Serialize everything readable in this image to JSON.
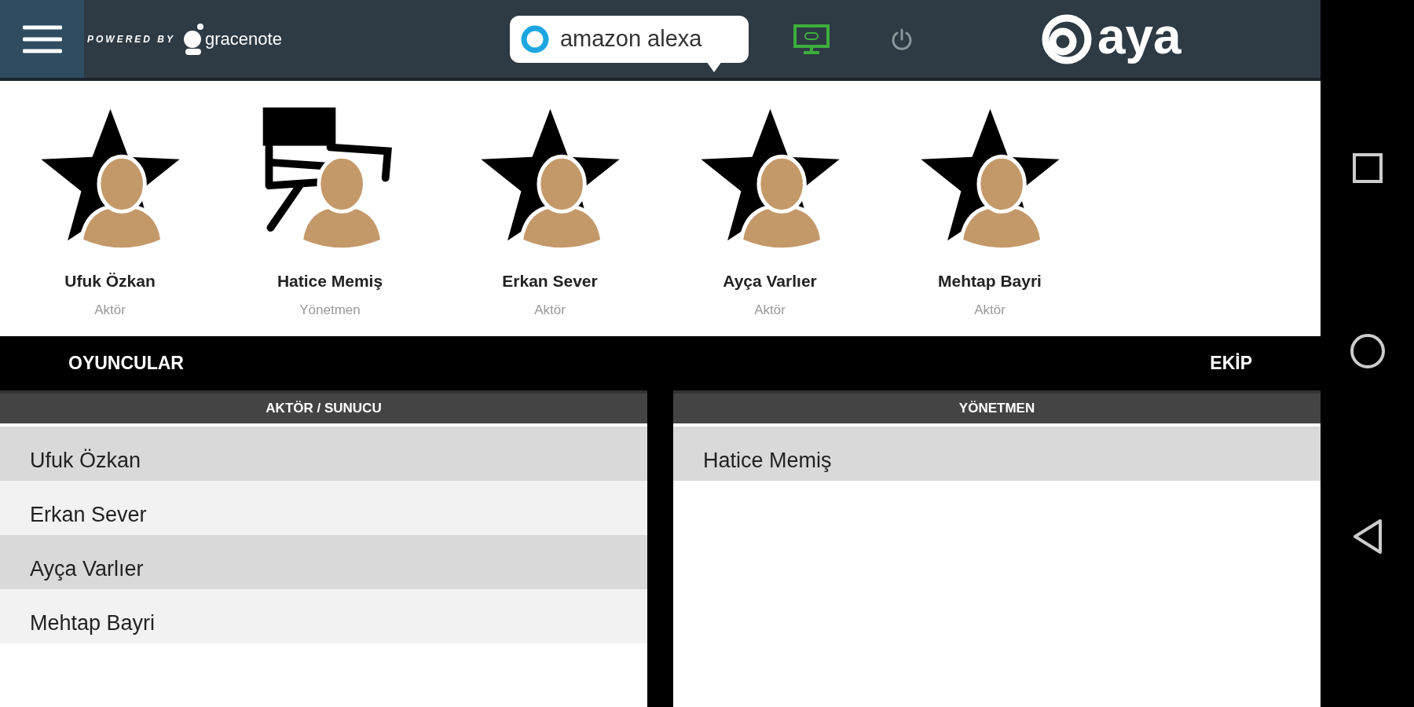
{
  "header": {
    "powered_by": "POWERED BY",
    "partner": "gracenote",
    "assistant": "amazon alexa",
    "brand": "aya"
  },
  "cast": [
    {
      "name": "Ufuk Özkan",
      "role": "Aktör",
      "kind": "actor"
    },
    {
      "name": "Hatice Memiş",
      "role": "Yönetmen",
      "kind": "director"
    },
    {
      "name": "Erkan Sever",
      "role": "Aktör",
      "kind": "actor"
    },
    {
      "name": "Ayça Varlıer",
      "role": "Aktör",
      "kind": "actor"
    },
    {
      "name": "Mehtap Bayri",
      "role": "Aktör",
      "kind": "actor"
    }
  ],
  "tabs": [
    "OYUNCULAR",
    "EKİP"
  ],
  "columns": [
    {
      "title": "AKTÖR / SUNUCU",
      "items": [
        "Ufuk Özkan",
        "Erkan Sever",
        "Ayça Varlıer",
        "Mehtap Bayri"
      ]
    },
    {
      "title": "YÖNETMEN",
      "items": [
        "Hatice Memiş"
      ]
    }
  ]
}
